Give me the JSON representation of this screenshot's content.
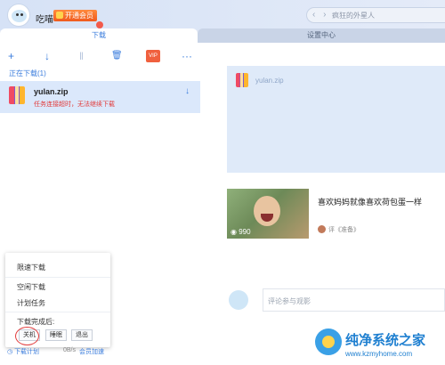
{
  "header": {
    "username": "吃喵",
    "vip_badge": "开通会员",
    "search_placeholder": "疯狂的外星人"
  },
  "tabs": [
    {
      "label": "下载",
      "active": true
    },
    {
      "label": "设置中心",
      "active": false
    }
  ],
  "toolbar": {
    "add_icon": "+",
    "download_icon": "↓",
    "pause_icon": "‖",
    "delete_icon": "🗑",
    "vip_label": "VIP",
    "more_icon": "···"
  },
  "downloading": {
    "title": "正在下载(1)",
    "items": [
      {
        "name": "yulan.zip",
        "status": "任务连接超时，无法继续下载",
        "arrow": "↓"
      }
    ]
  },
  "popup": {
    "limit_speed": "限速下载",
    "idle_download": "空闲下载",
    "scheduled_task": "计划任务",
    "after_done_label": "下载完成后:",
    "buttons": [
      "关机",
      "睡眠",
      "退出"
    ]
  },
  "bottom_bar": {
    "plan": "下载计划",
    "speed": "0B/s",
    "accelerate": "会员加速"
  },
  "preview": {
    "file_name": "yulan.zip"
  },
  "ad": {
    "views": "990",
    "title": "喜欢妈妈就像喜欢荷包蛋一样",
    "source": "评《准备》"
  },
  "comment": {
    "placeholder": "评论参与观影"
  },
  "watermark": {
    "title": "纯净系统之家",
    "url": "www.kzmyhome.com"
  },
  "colors": {
    "accent": "#3b7ddd",
    "error": "#e23b3b",
    "vip": "#f05a1e"
  }
}
